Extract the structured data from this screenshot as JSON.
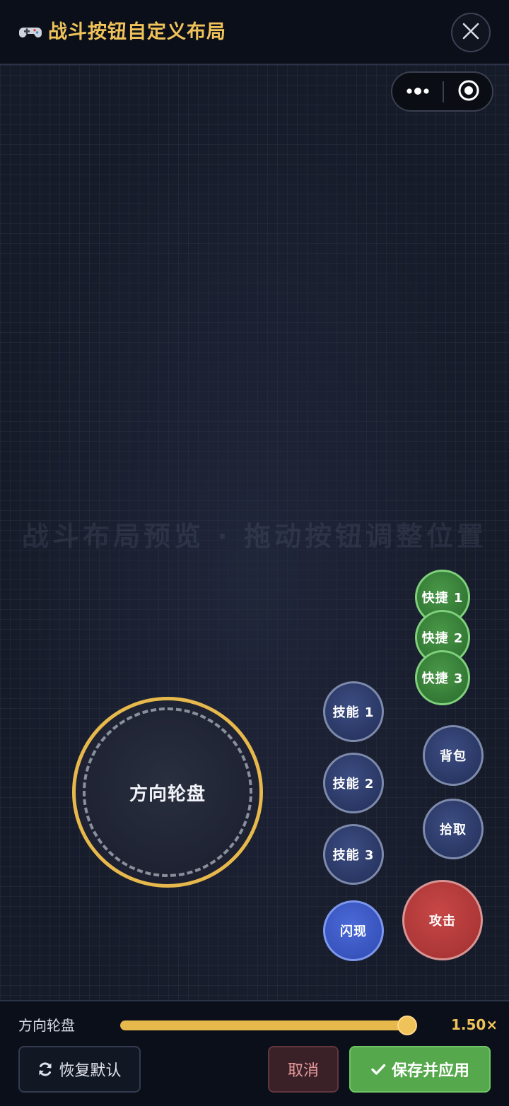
{
  "header": {
    "title": "战斗按钮自定义布局",
    "title_icon": "gamepad-icon",
    "close_icon": "close-icon"
  },
  "canvas": {
    "watermark": "战斗布局预览 · 拖动按钮调整位置",
    "capsule": {
      "more_icon": "more-dots-icon",
      "target_icon": "target-icon"
    }
  },
  "controls": {
    "joystick": "方向轮盘",
    "skill_1": "技能 1",
    "skill_2": "技能 2",
    "skill_3": "技能 3",
    "flash": "闪现",
    "quick_1": "快捷 1",
    "quick_2": "快捷 2",
    "quick_3": "快捷 3",
    "bag": "背包",
    "pickup": "拾取",
    "attack": "攻击"
  },
  "slider": {
    "label": "方向轮盘",
    "value_text": "1.50×",
    "fill_fraction": 1.0
  },
  "buttons": {
    "reset": "恢复默认",
    "reset_icon": "refresh-icon",
    "cancel": "取消",
    "save": "保存并应用",
    "save_icon": "check-icon"
  },
  "colors": {
    "accent": "#e7b84b",
    "save": "#55a84c",
    "cancel_text": "#e79a9a",
    "attack": "#a83434",
    "skill": "#273460",
    "quick": "#2f7432",
    "flash": "#3550b8"
  }
}
